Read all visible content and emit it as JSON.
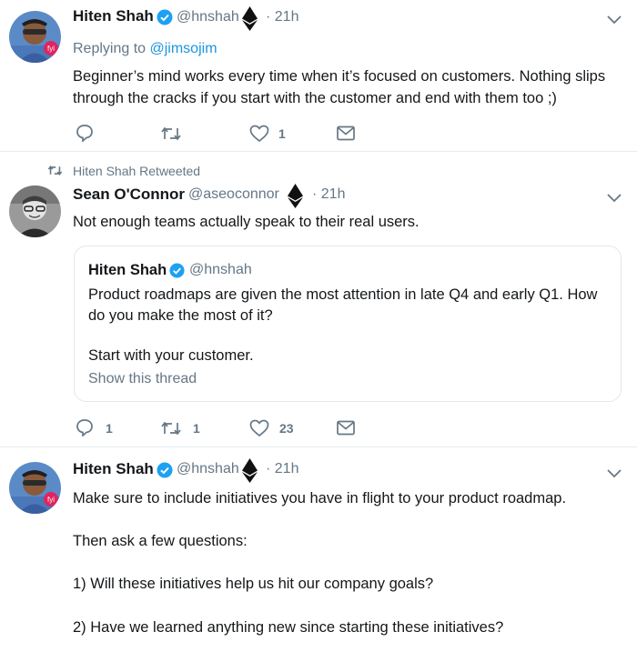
{
  "tweets": [
    {
      "name": "Hiten Shah",
      "handle": "@hnshah",
      "time": "· 21h",
      "replying_prefix": "Replying to ",
      "replying_to": "@jimsojim",
      "text_line1": "Beginner’s mind works every time when it’s focused on customers. Nothing slips",
      "text_line2": "through the cracks if you start with the customer and end with them too ;)",
      "reply_count": "",
      "retweet_count": "",
      "like_count": "1"
    },
    {
      "retweet_label": "Hiten Shah Retweeted",
      "name": "Sean O'Connor",
      "handle": "@aseoconnor",
      "time": "· 21h",
      "text": "Not enough teams actually speak to their real users.",
      "quote": {
        "name": "Hiten Shah",
        "handle": "@hnshah",
        "line1": "Product roadmaps are given the most attention in late Q4 and early Q1. How",
        "line2": "do you make the most of it?",
        "line3": "Start with your customer.",
        "show_thread": "Show this thread"
      },
      "reply_count": "1",
      "retweet_count": "1",
      "like_count": "23"
    },
    {
      "name": "Hiten Shah",
      "handle": "@hnshah",
      "time": "· 21h",
      "line1": "Make sure to include initiatives you have in flight to your product roadmap.",
      "line2": "Then ask a few questions:",
      "line3": "1) Will these initiatives help us hit our company goals?",
      "line4": "2) Have we learned anything new since starting these initiatives?"
    }
  ],
  "colors": {
    "verified": "#1da1f2",
    "link": "#1b95e0",
    "secondary": "#657786",
    "divider": "#e6ecf0"
  }
}
